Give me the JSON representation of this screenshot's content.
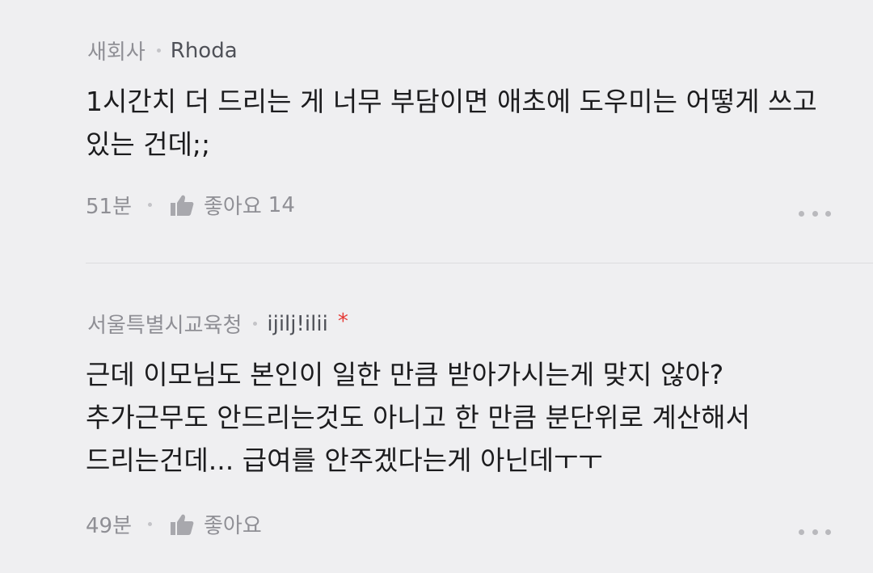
{
  "comments": [
    {
      "source": "새회사",
      "nickname": "Rhoda",
      "new_mark": "",
      "lines": [
        "1시간치 더 드리는 게 너무 부담이면 애초에 도우미는 어떻게 쓰고",
        "있는 건데;;"
      ],
      "time": "51분",
      "like_label": "좋아요",
      "like_count": "14"
    },
    {
      "source": "서울특별시교육청",
      "nickname": "ijilj!ilii",
      "new_mark": "*",
      "lines": [
        "근데 이모님도 본인이 일한 만큼 받아가시는게 맞지 않아?",
        "추가근무도 안드리는것도 아니고 한 만큼 분단위로 계산해서",
        "드리는건데... 급여를 안주겠다는게 아닌데ㅜㅜ"
      ],
      "time": "49분",
      "like_label": "좋아요",
      "like_count": ""
    }
  ],
  "icons": {
    "like": "thumbs-up-icon",
    "more": "more-dots-icon"
  },
  "colors": {
    "background": "#efeff1",
    "text": "#1c1c1e",
    "meta": "#8f8f95",
    "new_mark": "#e53935"
  }
}
